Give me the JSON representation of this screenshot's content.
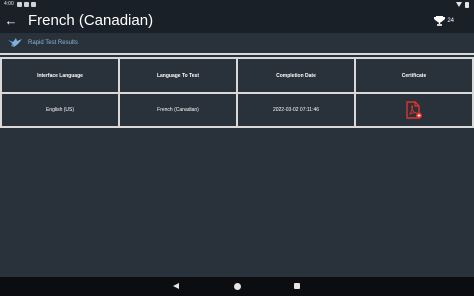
{
  "status_bar": {
    "time": "4:00"
  },
  "app_bar": {
    "back_icon": "arrow-left-icon",
    "title": "French (Canadian)",
    "trophy_icon": "trophy-icon",
    "trophy_count": "24"
  },
  "sub_bar": {
    "logo_icon": "bird-logo-icon",
    "title": "Rapid Test Results"
  },
  "results_table": {
    "headers": [
      "Interface Language",
      "Language To Test",
      "Completion Date",
      "Certificate"
    ],
    "rows": [
      {
        "interface_language": "English (US)",
        "language_to_test": "French (Canadian)",
        "completion_date": "2022-03-02 07:11:46",
        "certificate_icon": "pdf-certificate-icon"
      }
    ]
  },
  "colors": {
    "background": "#29313b",
    "app_bar": "#1a2027",
    "accent_link": "#8ab4d8",
    "certificate_red": "#e0332b"
  },
  "nav_bar": {
    "back_icon": "nav-back-icon",
    "home_icon": "nav-home-icon",
    "recents_icon": "nav-recents-icon"
  }
}
